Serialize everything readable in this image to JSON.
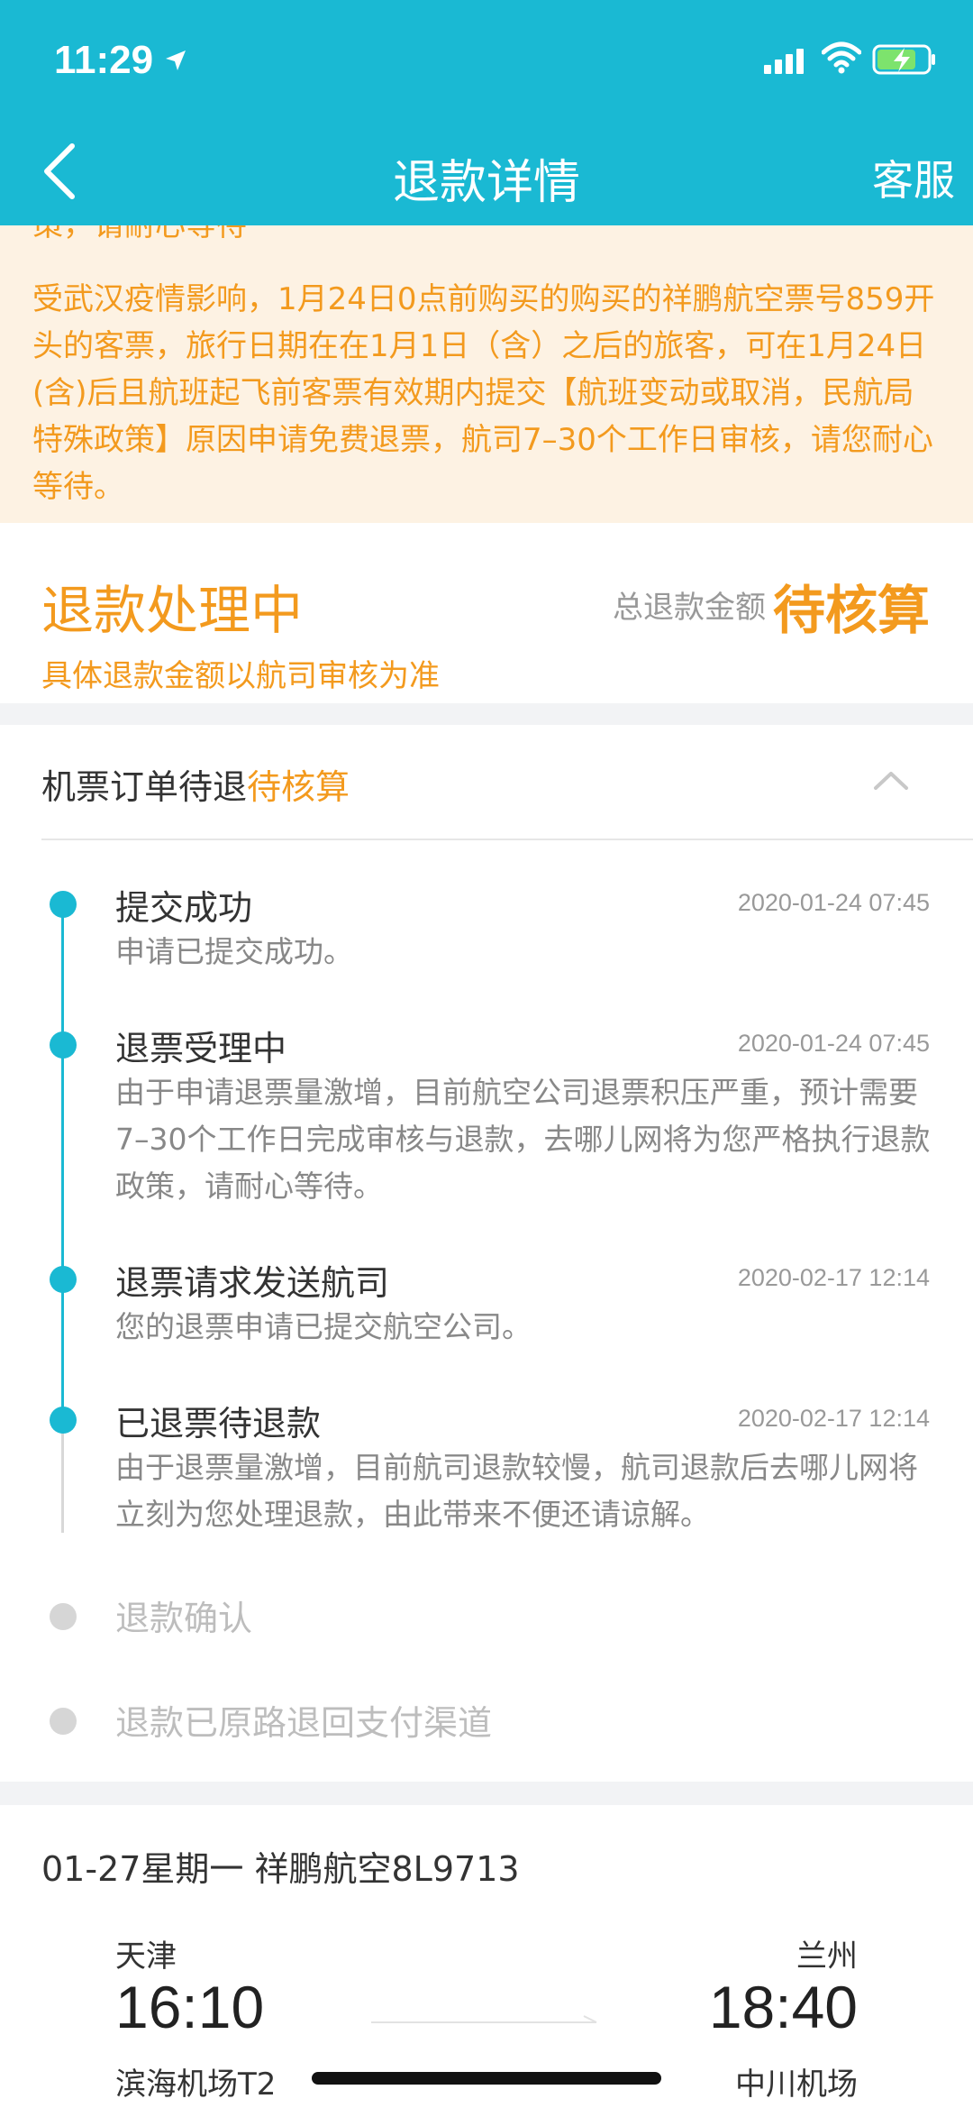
{
  "status_bar": {
    "time": "11:29"
  },
  "nav": {
    "title": "退款详情",
    "service": "客服"
  },
  "notice": {
    "clipped_text": "策，请耐心等待",
    "text": "受武汉疫情影响，1月24日0点前购买的购买的祥鹏航空票号859开头的客票，旅行日期在在1月1日（含）之后的旅客，可在1月24日(含)后且航班起飞前客票有效期内提交【航班变动或取消，民航局特殊政策】原因申请免费退票，航司7–30个工作日审核，请您耐心等待。"
  },
  "refund_status": {
    "title": "退款处理中",
    "subtitle": "具体退款金额以航司审核为准",
    "amount_label": "总退款金额",
    "amount_value": "待核算"
  },
  "order": {
    "label": "机票订单待退",
    "status": "待核算"
  },
  "steps": [
    {
      "title": "提交成功",
      "time": "2020-01-24 07:45",
      "desc": "申请已提交成功。",
      "done": true
    },
    {
      "title": "退票受理中",
      "time": "2020-01-24 07:45",
      "desc": "由于申请退票量激增，目前航空公司退票积压严重，预计需要7–30个工作日完成审核与退款，去哪儿网将为您严格执行退款政策，请耐心等待。",
      "done": true
    },
    {
      "title": "退票请求发送航司",
      "time": "2020-02-17 12:14",
      "desc": "您的退票申请已提交航空公司。",
      "done": true
    },
    {
      "title": "已退票待退款",
      "time": "2020-02-17 12:14",
      "desc": "由于退票量激增，目前航司退款较慢，航司退款后去哪儿网将立刻为您处理退款，由此带来不便还请谅解。",
      "done": true
    },
    {
      "title": "退款确认",
      "done": false
    },
    {
      "title": "退款已原路退回支付渠道",
      "done": false
    }
  ],
  "flight": {
    "info": "01-27星期一  祥鹏航空8L9713",
    "from_city": "天津",
    "to_city": "兰州",
    "dep_time": "16:10",
    "arr_time": "18:40",
    "from_airport": "滨海机场T2",
    "to_airport": "中川机场"
  },
  "colors": {
    "primary": "#1ab9d3",
    "accent": "#f39a1e",
    "notice_bg": "#fdf2e3"
  }
}
